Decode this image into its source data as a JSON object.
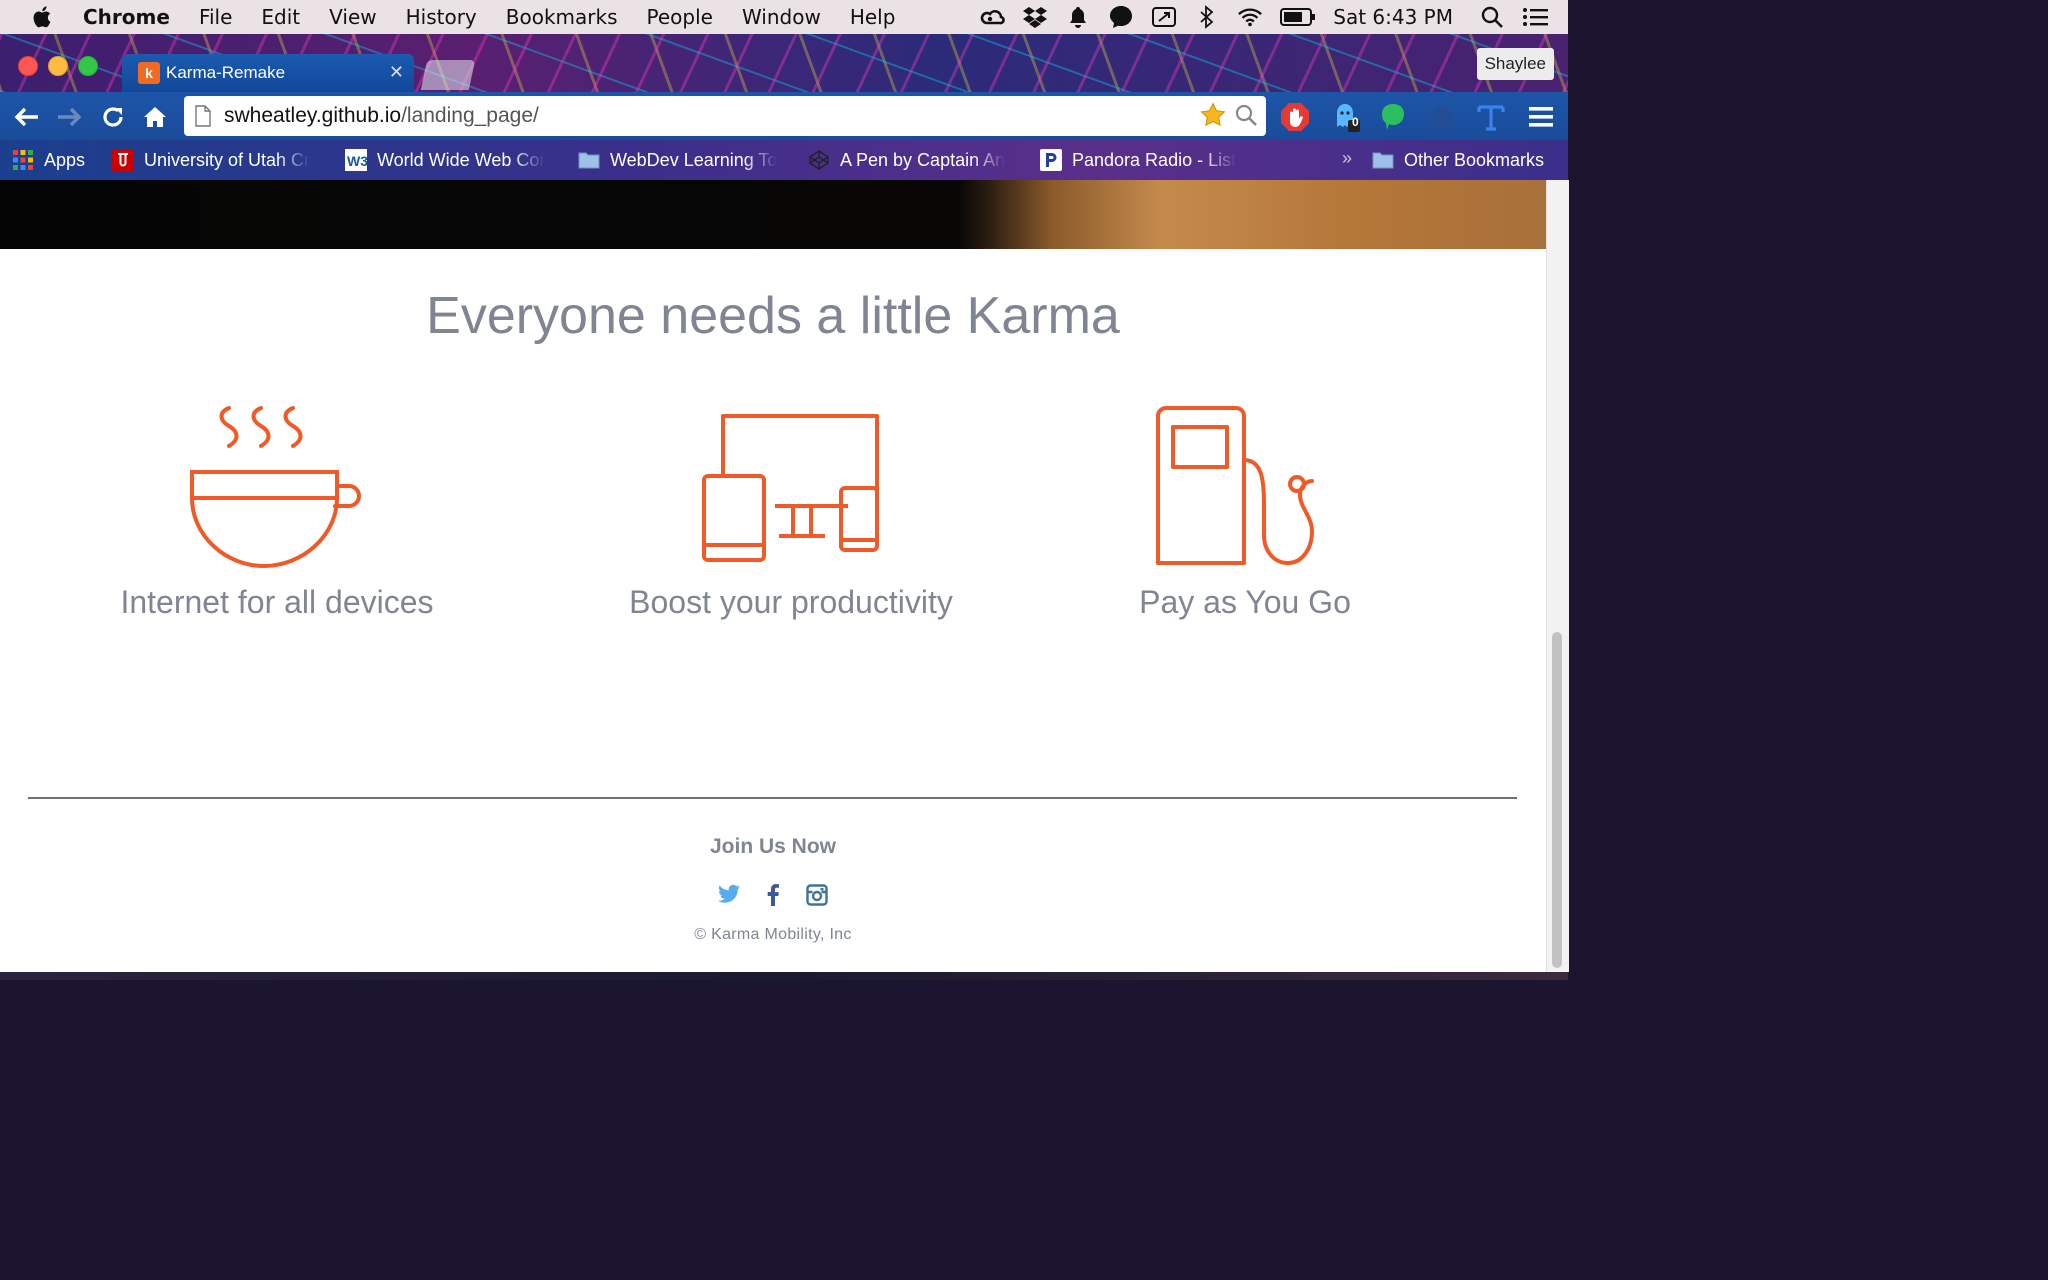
{
  "menubar": {
    "app_name": "Chrome",
    "menus": [
      "File",
      "Edit",
      "View",
      "History",
      "Bookmarks",
      "People",
      "Window",
      "Help"
    ],
    "clock": "Sat 6:43 PM",
    "status_icons": [
      "creative-cloud-icon",
      "dropbox-icon",
      "notification-bell-icon",
      "chat-bubble-icon",
      "screen-share-icon",
      "bluetooth-icon",
      "wifi-icon",
      "battery-icon",
      "spotlight-search-icon",
      "notification-center-icon"
    ]
  },
  "browser": {
    "tab_title": "Karma-Remake",
    "favicon_letter": "k",
    "profile_name": "Shaylee",
    "url_host": "swheatley.github.io",
    "url_path": "/landing_page/",
    "extension_badge": "0"
  },
  "bookmarks": {
    "apps": "Apps",
    "items": [
      "University of Utah Cr",
      "World Wide Web Cor",
      "WebDev Learning To",
      "A Pen by Captain An",
      "Pandora Radio - List"
    ],
    "overflow": "»",
    "other": "Other Bookmarks"
  },
  "page": {
    "headline": "Everyone needs a little Karma",
    "features": [
      {
        "label": "Internet for all devices",
        "icon": "coffee-cup-icon"
      },
      {
        "label": "Boost your productivity",
        "icon": "devices-icon"
      },
      {
        "label": "Pay as You Go",
        "icon": "fuel-pump-icon"
      }
    ],
    "footer": {
      "join": "Join Us Now",
      "copyright": "© Karma Mobility, Inc"
    }
  },
  "colors": {
    "accent_orange": "#ef5a28",
    "text_gray": "#7f8592",
    "twitter_blue": "#55acee",
    "facebook_blue": "#3b5998",
    "instagram_blue": "#3f729b"
  }
}
